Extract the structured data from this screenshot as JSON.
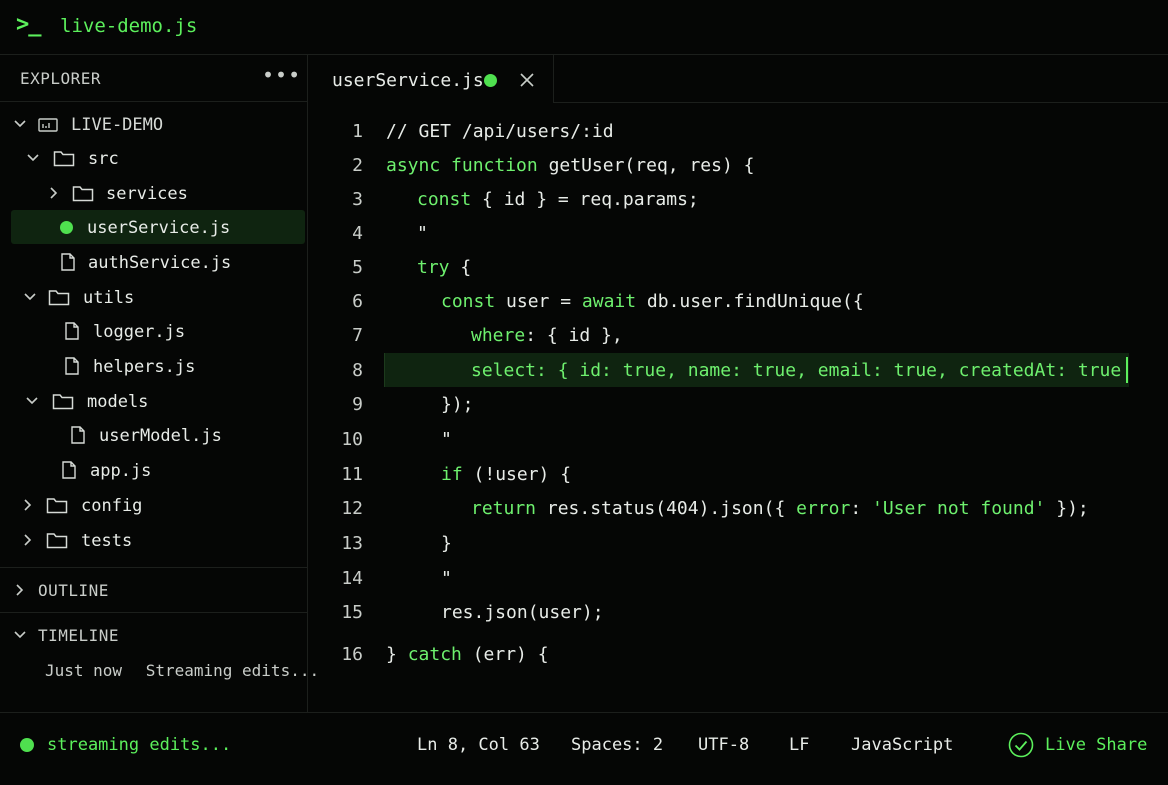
{
  "titlebar": {
    "prompt": ">_",
    "title": "live-demo.js"
  },
  "sidebar": {
    "header": "EXPLORER",
    "more": "•••",
    "tree": {
      "root": "LIVE-DEMO",
      "src": "src",
      "services": "services",
      "userService": "userService.js",
      "authService": "authService.js",
      "utils": "utils",
      "logger": "logger.js",
      "helpers": "helpers.js",
      "models": "models",
      "userModel": "userModel.js",
      "app": "app.js",
      "config": "config",
      "tests": "tests"
    },
    "outline": "OUTLINE",
    "timeline": "TIMELINE",
    "timeline_entry": {
      "time": "Just now",
      "text": "Streaming edits..."
    }
  },
  "tab": {
    "name": "userService.js",
    "modified": true
  },
  "editor": {
    "line_numbers": [
      "1",
      "2",
      "3",
      "4",
      "5",
      "6",
      "7",
      "8",
      "9",
      "10",
      "11",
      "12",
      "13",
      "14",
      "15",
      "16"
    ],
    "lines": [
      "// GET /api/users/:id",
      "async function getUser(req, res) {",
      "const { id } = req.params;",
      "\"",
      "try {",
      "const user = await db.user.findUnique({",
      "where: { id },",
      "select: { id: true, name: true, email: true, createdAt: true",
      "});",
      "\"",
      "if (!user) {",
      "return res.status(404).json({ error: 'User not found' });",
      "}",
      "\"",
      "res.json(user);",
      "} catch (err) {"
    ],
    "active_line": 8
  },
  "statusbar": {
    "status": "streaming edits...",
    "cursor": "Ln 8, Col 63",
    "spaces": "Spaces: 2",
    "encoding": "UTF-8",
    "eol": "LF",
    "language": "JavaScript",
    "live_share": "Live Share"
  },
  "colors": {
    "accent": "#5cf05c",
    "background": "#050605",
    "highlight": "#0f2410"
  }
}
